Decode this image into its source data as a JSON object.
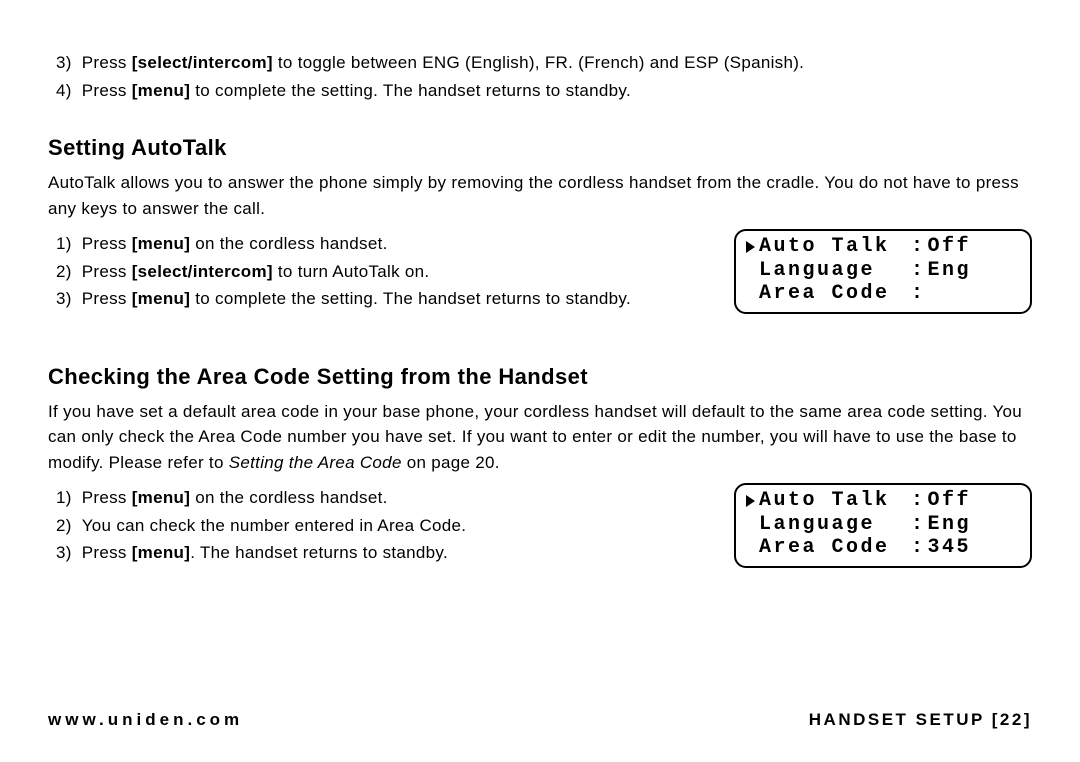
{
  "intro_steps": {
    "s3": {
      "num": "3)",
      "pre": "Press",
      "bold": "[select/intercom]",
      "post": "to toggle between ENG (English), FR. (French) and ESP (Spanish)."
    },
    "s4": {
      "num": "4)",
      "pre": "Press",
      "bold": "[menu]",
      "post": "to complete the setting. The handset returns to standby."
    }
  },
  "autotalk": {
    "heading": "Setting AutoTalk",
    "para": "AutoTalk allows you to answer the phone simply by removing the cordless handset from the cradle. You do not have to press any keys to answer the call.",
    "steps": {
      "s1": {
        "num": "1)",
        "pre": "Press",
        "bold": "[menu]",
        "post": "on the cordless handset."
      },
      "s2": {
        "num": "2)",
        "pre": "Press",
        "bold": "[select/intercom]",
        "post": "to turn AutoTalk on."
      },
      "s3": {
        "num": "3)",
        "pre": "Press",
        "bold": "[menu]",
        "post": "to complete the setting. The handset returns to standby."
      }
    },
    "lcd": {
      "r1": {
        "label": "Auto Talk",
        "value": "Off"
      },
      "r2": {
        "label": "Language",
        "value": "Eng"
      },
      "r3": {
        "label": "Area Code",
        "value": ""
      }
    }
  },
  "areacode": {
    "heading": "Checking the Area Code Setting from the Handset",
    "para_pre": "If you have set a default area code in your base phone, your cordless handset will default to the same area code setting. You can only check the Area Code number you have set. If you want to enter or edit the number, you will have to use the base to modify. Please refer to ",
    "para_ref": "Setting the Area Code",
    "para_post": " on page 20.",
    "steps": {
      "s1": {
        "num": "1)",
        "pre": "Press",
        "bold": "[menu]",
        "post": "on the cordless handset."
      },
      "s2": {
        "num": "2)",
        "text": "You can check the number entered in Area Code."
      },
      "s3": {
        "num": "3)",
        "pre": "Press",
        "bold": "[menu]",
        "post": ". The handset returns to standby."
      }
    },
    "lcd": {
      "r1": {
        "label": "Auto Talk",
        "value": "Off"
      },
      "r2": {
        "label": "Language",
        "value": "Eng"
      },
      "r3": {
        "label": "Area Code",
        "value": "345"
      }
    }
  },
  "footer": {
    "url": "www.uniden.com",
    "section": "HANDSET SETUP",
    "page": "[22]"
  }
}
